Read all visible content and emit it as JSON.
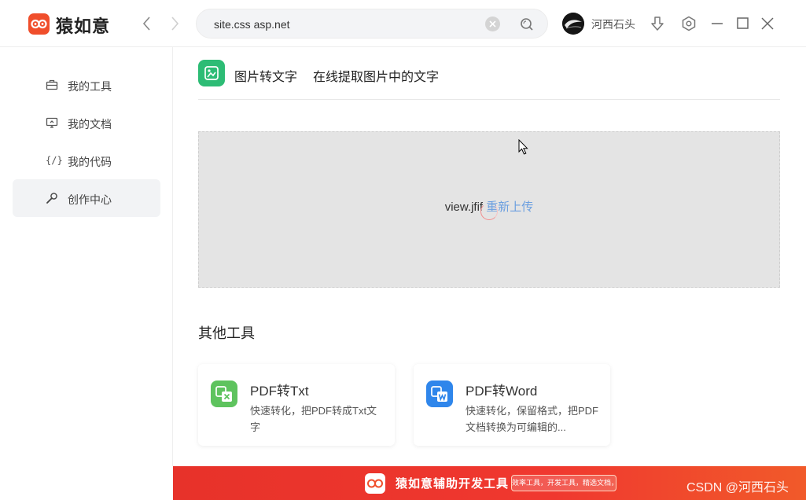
{
  "app": {
    "name": "猿如意"
  },
  "search": {
    "value": "site.css asp.net"
  },
  "user": {
    "name": "河西石头"
  },
  "sidebar": {
    "items": [
      {
        "label": "我的工具",
        "icon": "briefcase-icon"
      },
      {
        "label": "我的文档",
        "icon": "monitor-icon"
      },
      {
        "label": "我的代码",
        "icon": "code-icon"
      },
      {
        "label": "创作中心",
        "icon": "wrench-icon",
        "active": true
      }
    ]
  },
  "tool": {
    "name": "图片转文字",
    "description": "在线提取图片中的文字",
    "icon_color": "#2dbc75"
  },
  "upload": {
    "file_name": "view.jfif",
    "reupload_label": "重新上传"
  },
  "other_tools": {
    "title": "其他工具",
    "cards": [
      {
        "title": "PDF转Txt",
        "description": "快速转化，把PDF转成Txt文字",
        "icon": "pdf-to-txt-icon",
        "icon_color": "#5ec35e"
      },
      {
        "title": "PDF转Word",
        "description": "快速转化，保留格式，把PDF文档转换为可编辑的...",
        "icon": "pdf-to-word-icon",
        "icon_color": "#2f86eb"
      }
    ]
  },
  "banner": {
    "title": "猿如意辅助开发工具",
    "tagline": "效率工具，开发工具，精选文档，一行代码",
    "watermark": "CSDN @河西石头"
  },
  "colors": {
    "brand": "#f04e2b",
    "link": "#6b9fe0",
    "banner": "#e7322a"
  }
}
